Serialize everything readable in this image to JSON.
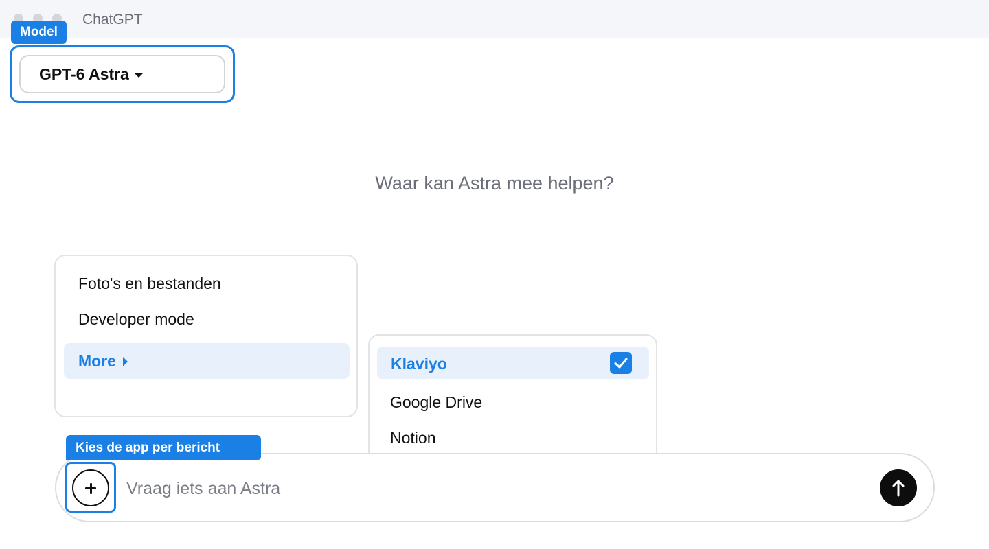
{
  "window": {
    "title": "ChatGPT"
  },
  "callouts": {
    "model": "Model",
    "app_picker": "Kies de app per bericht"
  },
  "model_selector": {
    "label": "GPT-6 Astra",
    "icon": "caret-down-icon"
  },
  "main": {
    "heading": "Waar kan Astra mee helpen?"
  },
  "attach_menu": {
    "items": [
      {
        "label": "Foto's en bestanden"
      },
      {
        "label": "Developer mode"
      }
    ],
    "more": {
      "label": "More",
      "icon": "caret-right-icon"
    }
  },
  "apps_menu": {
    "items": [
      {
        "label": "Klaviyo",
        "checked": true
      },
      {
        "label": "Google Drive",
        "checked": false
      },
      {
        "label": "Notion",
        "checked": false
      }
    ]
  },
  "composer": {
    "placeholder": "Vraag iets aan Astra",
    "add_icon": "plus-icon",
    "send_icon": "arrow-up-icon"
  },
  "colors": {
    "accent": "#1a80e6",
    "highlight_bg": "#e8f1fb",
    "send_bg": "#0d0d0d",
    "muted_text": "#6b6e78"
  }
}
